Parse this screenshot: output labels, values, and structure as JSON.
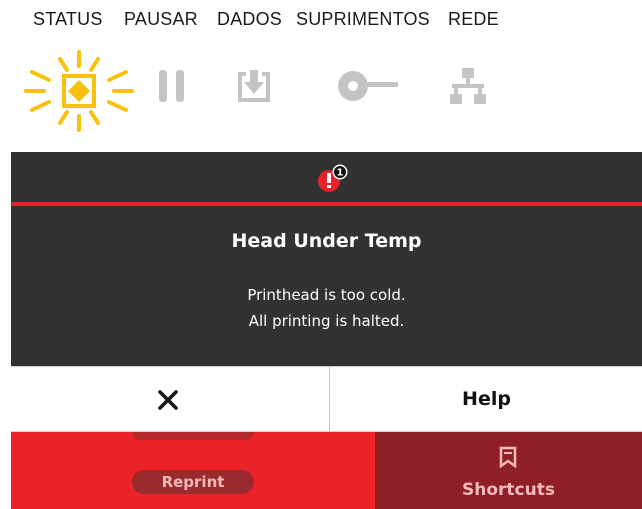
{
  "menu": {
    "tabs": [
      {
        "label": "STATUS",
        "icon": "status-sun-icon",
        "active": true
      },
      {
        "label": "PAUSAR",
        "icon": "pause-icon"
      },
      {
        "label": "DADOS",
        "icon": "data-download-icon"
      },
      {
        "label": "SUPRIMENTOS",
        "icon": "supplies-ribbon-icon"
      },
      {
        "label": "REDE",
        "icon": "network-icon"
      }
    ]
  },
  "alert": {
    "badge_count": "1",
    "title": "Head Under Temp",
    "message_line1": "Printhead is too cold.",
    "message_line2": "All printing is halted."
  },
  "buttons": {
    "close_icon": "close-icon",
    "help_label": "Help"
  },
  "background": {
    "reprint_label": "Reprint",
    "shortcuts_label": "Shortcuts"
  },
  "colors": {
    "accent_yellow": "#f9c10f",
    "inactive_icon": "#c4c4c4",
    "panel_dark": "#323232",
    "alert_red": "#e8202a",
    "bottom_red": "#ec2229",
    "bottom_dark_red": "#8f1f27"
  }
}
